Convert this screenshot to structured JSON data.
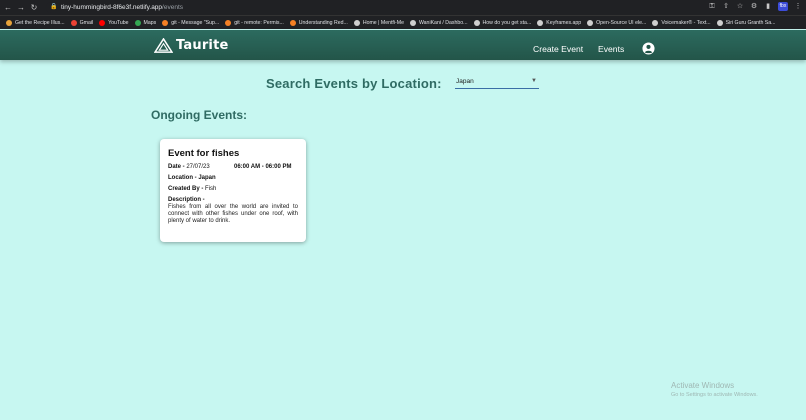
{
  "browser": {
    "url_host": "tiny-hummingbird-8f6e3f.netlify.app",
    "url_path": "/events",
    "profile_initials": "fbx"
  },
  "bookmarks": [
    {
      "label": "Get the Recipe Illus...",
      "color": "#e8a33a"
    },
    {
      "label": "Gmail",
      "color": "#ea4335"
    },
    {
      "label": "YouTube",
      "color": "#ff0000"
    },
    {
      "label": "Maps",
      "color": "#34a853"
    },
    {
      "label": "git - Message \"Sup...",
      "color": "#f48024"
    },
    {
      "label": "git - remote: Permis...",
      "color": "#f48024"
    },
    {
      "label": "Understanding Red...",
      "color": "#f48024"
    },
    {
      "label": "Home | Mentfi-Me",
      "color": "#cfcfcf"
    },
    {
      "label": "WaniKani / Dashbo...",
      "color": "#cfcfcf"
    },
    {
      "label": "How do you get sta...",
      "color": "#cfcfcf"
    },
    {
      "label": "Keyframes.app",
      "color": "#cfcfcf"
    },
    {
      "label": "Open-Source UI ele...",
      "color": "#cfcfcf"
    },
    {
      "label": "Voicemaker® - Text...",
      "color": "#cfcfcf"
    },
    {
      "label": "Siri Guru Granth Sa...",
      "color": "#cfcfcf"
    }
  ],
  "header": {
    "brand": "Taurite",
    "nav": [
      {
        "label": "Create Event"
      },
      {
        "label": "Events"
      }
    ]
  },
  "search": {
    "title": "Search Events by Location:",
    "selected": "Japan"
  },
  "ongoing": {
    "title": "Ongoing Events:"
  },
  "event": {
    "title": "Event for fishes",
    "date_label": "Date -",
    "date": "27/07/23",
    "time": "06:00 AM - 06:00 PM",
    "location_label": "Location -",
    "location": "Japan",
    "created_by_label": "Created By -",
    "created_by": "Fish",
    "description_label": "Description -",
    "description": "Fishes from all over the world are invited to connect with other fishes under one roof, with plenty of water to drink."
  },
  "watermark": {
    "title": "Activate Windows",
    "subtitle": "Go to Settings to activate Windows."
  },
  "colors": {
    "page_bg": "#c7f7f1",
    "header_bg": "#235549",
    "heading_text": "#2f6b63"
  }
}
